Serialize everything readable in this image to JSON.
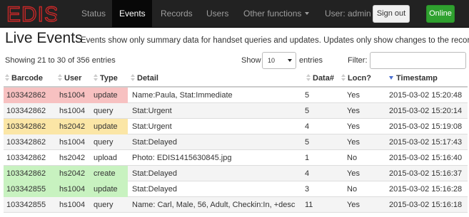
{
  "navbar": {
    "brand": "EDIS",
    "items": [
      {
        "label": "Status",
        "active": false
      },
      {
        "label": "Events",
        "active": true
      },
      {
        "label": "Records",
        "active": false
      },
      {
        "label": "Users",
        "active": false
      },
      {
        "label": "Other functions",
        "active": false,
        "dropdown": true
      }
    ],
    "user_label": "User: admin",
    "signout_label": "Sign out",
    "status_label": "Online",
    "colors": {
      "background": "#222222",
      "brand": "#c62828",
      "online": "#2fa12f"
    }
  },
  "page": {
    "title": "Live Events",
    "description": "Events show only summary data for handset queries and updates. Updates only show changes to the record."
  },
  "controls": {
    "info": "Showing 21 to 30 of 356 entries",
    "show_label": "Show",
    "page_size": "10",
    "entries_label": "entries",
    "filter_label": "Filter:",
    "filter_value": ""
  },
  "table": {
    "columns": [
      {
        "label": "Barcode",
        "sort": "both"
      },
      {
        "label": "User",
        "sort": "both"
      },
      {
        "label": "Type",
        "sort": "both"
      },
      {
        "label": "Detail",
        "sort": "both"
      },
      {
        "label": "Data#",
        "sort": "both"
      },
      {
        "label": "Locn?",
        "sort": "both"
      },
      {
        "label": "Timestamp",
        "sort": "desc"
      }
    ],
    "rows": [
      {
        "barcode": "103342862",
        "user": "hs1004",
        "type": "update",
        "detail": "Name:Paula, Stat:Immediate",
        "data": "5",
        "locn": "Yes",
        "timestamp": "2015-03-02 15:20:48",
        "highlight": "#f7c1c1"
      },
      {
        "barcode": "103342862",
        "user": "hs1004",
        "type": "query",
        "detail": "Stat:Urgent",
        "data": "5",
        "locn": "Yes",
        "timestamp": "2015-03-02 15:20:14",
        "highlight": ""
      },
      {
        "barcode": "103342862",
        "user": "hs2042",
        "type": "update",
        "detail": "Stat:Urgent",
        "data": "4",
        "locn": "Yes",
        "timestamp": "2015-03-02 15:19:08",
        "highlight": "#fbe6a6"
      },
      {
        "barcode": "103342862",
        "user": "hs1004",
        "type": "query",
        "detail": "Stat:Delayed",
        "data": "5",
        "locn": "Yes",
        "timestamp": "2015-03-02 15:17:43",
        "highlight": ""
      },
      {
        "barcode": "103342862",
        "user": "hs2042",
        "type": "upload",
        "detail": "Photo: EDIS1415630845.jpg",
        "data": "1",
        "locn": "No",
        "timestamp": "2015-03-02 15:16:40",
        "highlight": ""
      },
      {
        "barcode": "103342862",
        "user": "hs2042",
        "type": "create",
        "detail": "Stat:Delayed",
        "data": "4",
        "locn": "Yes",
        "timestamp": "2015-03-02 15:16:37",
        "highlight": "#c8f2c0"
      },
      {
        "barcode": "103342855",
        "user": "hs1004",
        "type": "update",
        "detail": "Stat:Delayed",
        "data": "3",
        "locn": "No",
        "timestamp": "2015-03-02 15:16:28",
        "highlight": "#c8f2c0"
      },
      {
        "barcode": "103342855",
        "user": "hs1004",
        "type": "query",
        "detail": "Name: Carl, Male, 56, Adult, Checkin:In, +desc",
        "data": "11",
        "locn": "Yes",
        "timestamp": "2015-03-02 15:16:18",
        "highlight": ""
      }
    ]
  }
}
